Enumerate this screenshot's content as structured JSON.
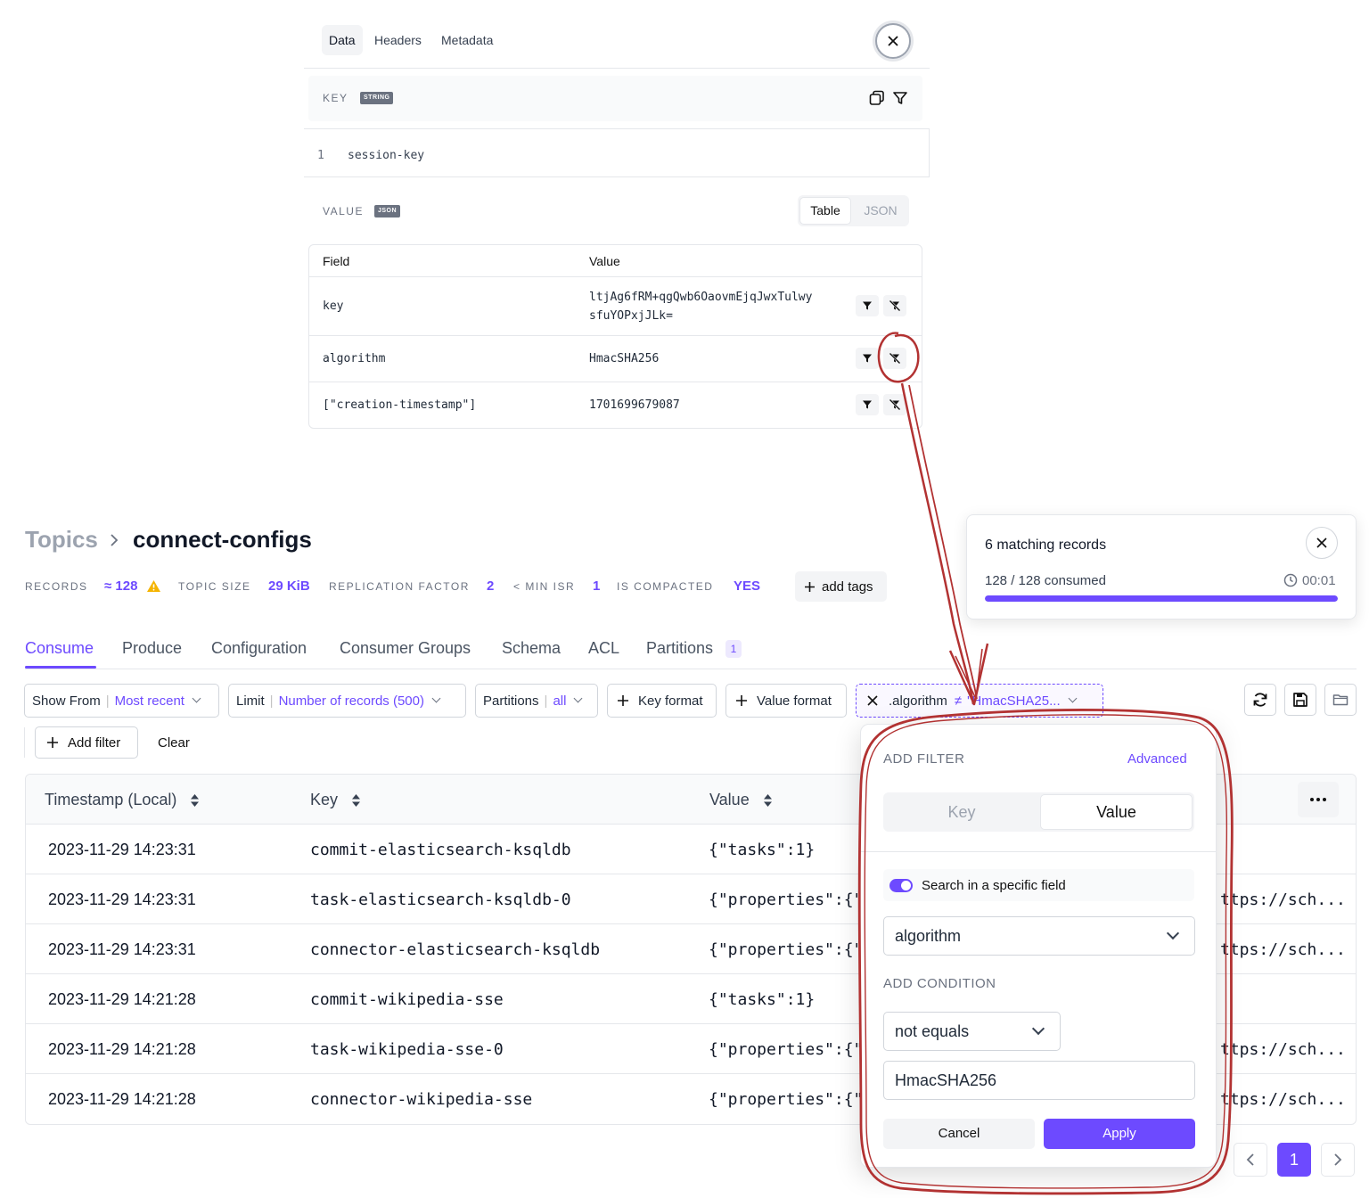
{
  "detail_panel": {
    "tabs": [
      {
        "label": "Data",
        "active": true
      },
      {
        "label": "Headers",
        "active": false
      },
      {
        "label": "Metadata",
        "active": false
      }
    ],
    "key_section": {
      "label": "KEY",
      "type_badge": "STRING",
      "line_number": "1",
      "value": "session-key"
    },
    "value_section": {
      "label": "VALUE",
      "type_badge": "JSON",
      "view_toggle": [
        {
          "label": "Table",
          "active": true
        },
        {
          "label": "JSON",
          "active": false
        }
      ],
      "columns": {
        "field": "Field",
        "value": "Value"
      },
      "rows": [
        {
          "field": "key",
          "value_line1": "ltjAg6fRM+qgQwb6OaovmEjqJwxTulwy",
          "value_line2": "sfuYOPxjJLk="
        },
        {
          "field": "algorithm",
          "value_line1": "HmacSHA256",
          "value_line2": ""
        },
        {
          "field": "[\"creation-timestamp\"]",
          "value_line1": "1701699679087",
          "value_line2": ""
        }
      ]
    }
  },
  "breadcrumb": {
    "parent": "Topics",
    "current": "connect-configs"
  },
  "stats": {
    "records_label": "RECORDS",
    "records_value": "≈ 128",
    "size_label": "TOPIC SIZE",
    "size_value": "29 KiB",
    "replication_label": "REPLICATION FACTOR",
    "replication_value": "2",
    "isr_label": "< MIN ISR",
    "isr_value": "1",
    "compacted_label": "IS COMPACTED",
    "compacted_value": "YES",
    "add_tags": "add tags"
  },
  "nav_tabs": [
    {
      "label": "Consume",
      "active": true
    },
    {
      "label": "Produce",
      "active": false
    },
    {
      "label": "Configuration",
      "active": false
    },
    {
      "label": "Consumer Groups",
      "active": false
    },
    {
      "label": "Schema",
      "active": false
    },
    {
      "label": "ACL",
      "active": false
    },
    {
      "label": "Partitions",
      "active": false,
      "badge": "1"
    }
  ],
  "toolbar": {
    "show_from": {
      "label": "Show From",
      "value": "Most recent"
    },
    "limit": {
      "label": "Limit",
      "value": "Number of records (500)"
    },
    "partitions": {
      "label": "Partitions",
      "value": "all"
    },
    "key_format": "Key format",
    "value_format": "Value format",
    "active_filter": {
      "field": ".algorithm",
      "operator": "≠",
      "value": "\"HmacSHA25..."
    },
    "add_filter": "Add filter",
    "clear": "Clear"
  },
  "records_table": {
    "columns": [
      "Timestamp (Local)",
      "Key",
      "Value"
    ],
    "rows": [
      {
        "timestamp": "2023-11-29 14:23:31",
        "key": "commit-elasticsearch-ksqldb",
        "value": "{\"tasks\":1}",
        "extra": ""
      },
      {
        "timestamp": "2023-11-29 14:23:31",
        "key": "task-elasticsearch-ksqldb-0",
        "value": "{\"properties\":{\"",
        "extra": "ttps://sch..."
      },
      {
        "timestamp": "2023-11-29 14:23:31",
        "key": "connector-elasticsearch-ksqldb",
        "value": "{\"properties\":{\"",
        "extra": "ttps://sch..."
      },
      {
        "timestamp": "2023-11-29 14:21:28",
        "key": "commit-wikipedia-sse",
        "value": "{\"tasks\":1}",
        "extra": ""
      },
      {
        "timestamp": "2023-11-29 14:21:28",
        "key": "task-wikipedia-sse-0",
        "value": "{\"properties\":{\"",
        "extra": "ttps://sch..."
      },
      {
        "timestamp": "2023-11-29 14:21:28",
        "key": "connector-wikipedia-sse",
        "value": "{\"properties\":{\"",
        "extra": "ttps://sch..."
      }
    ]
  },
  "progress": {
    "title": "6 matching records",
    "consumed": "128 / 128 consumed",
    "elapsed": "00:01",
    "fraction": 1.0
  },
  "filter_popover": {
    "title": "ADD FILTER",
    "advanced": "Advanced",
    "segments": [
      {
        "label": "Key",
        "active": false
      },
      {
        "label": "Value",
        "active": true
      }
    ],
    "toggle_label": "Search in a specific field",
    "toggle_on": true,
    "field": "algorithm",
    "condition_title": "ADD CONDITION",
    "condition": "not equals",
    "condition_value": "HmacSHA256",
    "cancel": "Cancel",
    "apply": "Apply"
  },
  "pagination": {
    "current": "1"
  },
  "colors": {
    "accent": "#6d4aff",
    "annotation": "#b23232",
    "warning": "#f5b400"
  }
}
